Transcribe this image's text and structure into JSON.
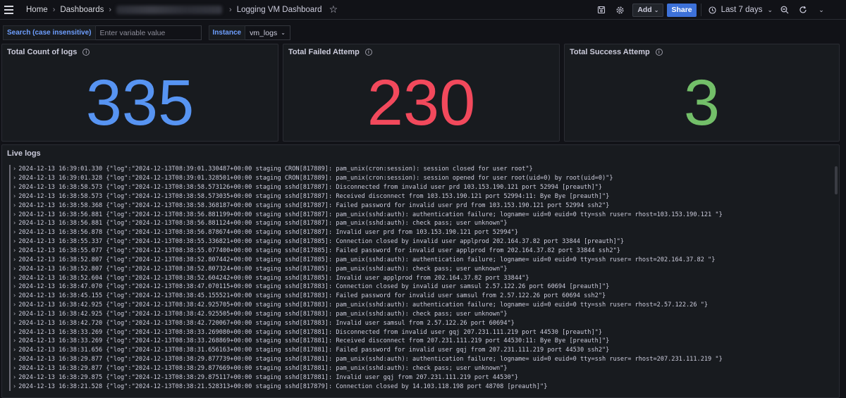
{
  "breadcrumb": {
    "home": "Home",
    "dashboards": "Dashboards",
    "current": "Logging VM Dashboard"
  },
  "toolbar": {
    "add_label": "Add",
    "share_label": "Share",
    "time_range": "Last 7 days"
  },
  "variables": {
    "search_label": "Search (case insensitive)",
    "search_placeholder": "Enter variable value",
    "instance_label": "Instance",
    "instance_value": "vm_logs"
  },
  "stats": [
    {
      "title": "Total Count of logs",
      "value": "335",
      "color": "#5794f2"
    },
    {
      "title": "Total Failed Attemp",
      "value": "230",
      "color": "#f2495c"
    },
    {
      "title": "Total Success Attemp",
      "value": "3",
      "color": "#73bf69"
    }
  ],
  "logs": {
    "title": "Live logs",
    "lines": [
      "2024-12-13 16:39:01.330 {\"log\":\"2024-12-13T08:39:01.330487+00:00 staging CRON[817889]: pam_unix(cron:session): session closed for user root\"}",
      "2024-12-13 16:39:01.328 {\"log\":\"2024-12-13T08:39:01.328501+00:00 staging CRON[817889]: pam_unix(cron:session): session opened for user root(uid=0) by root(uid=0)\"}",
      "2024-12-13 16:38:58.573 {\"log\":\"2024-12-13T08:38:58.573126+00:00 staging sshd[817887]: Disconnected from invalid user prd 103.153.190.121 port 52994 [preauth]\"}",
      "2024-12-13 16:38:58.573 {\"log\":\"2024-12-13T08:38:58.573035+00:00 staging sshd[817887]: Received disconnect from 103.153.190.121 port 52994:11: Bye Bye [preauth]\"}",
      "2024-12-13 16:38:58.368 {\"log\":\"2024-12-13T08:38:58.368187+00:00 staging sshd[817887]: Failed password for invalid user prd from 103.153.190.121 port 52994 ssh2\"}",
      "2024-12-13 16:38:56.881 {\"log\":\"2024-12-13T08:38:56.881199+00:00 staging sshd[817887]: pam_unix(sshd:auth): authentication failure; logname= uid=0 euid=0 tty=ssh ruser= rhost=103.153.190.121 \"}",
      "2024-12-13 16:38:56.881 {\"log\":\"2024-12-13T08:38:56.881124+00:00 staging sshd[817887]: pam_unix(sshd:auth): check pass; user unknown\"}",
      "2024-12-13 16:38:56.878 {\"log\":\"2024-12-13T08:38:56.878674+00:00 staging sshd[817887]: Invalid user prd from 103.153.190.121 port 52994\"}",
      "2024-12-13 16:38:55.337 {\"log\":\"2024-12-13T08:38:55.336821+00:00 staging sshd[817885]: Connection closed by invalid user applprod 202.164.37.82 port 33844 [preauth]\"}",
      "2024-12-13 16:38:55.077 {\"log\":\"2024-12-13T08:38:55.077400+00:00 staging sshd[817885]: Failed password for invalid user applprod from 202.164.37.82 port 33844 ssh2\"}",
      "2024-12-13 16:38:52.807 {\"log\":\"2024-12-13T08:38:52.807442+00:00 staging sshd[817885]: pam_unix(sshd:auth): authentication failure; logname= uid=0 euid=0 tty=ssh ruser= rhost=202.164.37.82 \"}",
      "2024-12-13 16:38:52.807 {\"log\":\"2024-12-13T08:38:52.807324+00:00 staging sshd[817885]: pam_unix(sshd:auth): check pass; user unknown\"}",
      "2024-12-13 16:38:52.604 {\"log\":\"2024-12-13T08:38:52.604242+00:00 staging sshd[817885]: Invalid user applprod from 202.164.37.82 port 33844\"}",
      "2024-12-13 16:38:47.070 {\"log\":\"2024-12-13T08:38:47.070115+00:00 staging sshd[817883]: Connection closed by invalid user samsul 2.57.122.26 port 60694 [preauth]\"}",
      "2024-12-13 16:38:45.155 {\"log\":\"2024-12-13T08:38:45.155521+00:00 staging sshd[817883]: Failed password for invalid user samsul from 2.57.122.26 port 60694 ssh2\"}",
      "2024-12-13 16:38:42.925 {\"log\":\"2024-12-13T08:38:42.925705+00:00 staging sshd[817883]: pam_unix(sshd:auth): authentication failure; logname= uid=0 euid=0 tty=ssh ruser= rhost=2.57.122.26 \"}",
      "2024-12-13 16:38:42.925 {\"log\":\"2024-12-13T08:38:42.925505+00:00 staging sshd[817883]: pam_unix(sshd:auth): check pass; user unknown\"}",
      "2024-12-13 16:38:42.720 {\"log\":\"2024-12-13T08:38:42.720067+00:00 staging sshd[817883]: Invalid user samsul from 2.57.122.26 port 60694\"}",
      "2024-12-13 16:38:33.269 {\"log\":\"2024-12-13T08:38:33.269080+00:00 staging sshd[817881]: Disconnected from invalid user gqj 207.231.111.219 port 44530 [preauth]\"}",
      "2024-12-13 16:38:33.269 {\"log\":\"2024-12-13T08:38:33.268869+00:00 staging sshd[817881]: Received disconnect from 207.231.111.219 port 44530:11: Bye Bye [preauth]\"}",
      "2024-12-13 16:38:31.656 {\"log\":\"2024-12-13T08:38:31.656163+00:00 staging sshd[817881]: Failed password for invalid user gqj from 207.231.111.219 port 44530 ssh2\"}",
      "2024-12-13 16:38:29.877 {\"log\":\"2024-12-13T08:38:29.877739+00:00 staging sshd[817881]: pam_unix(sshd:auth): authentication failure; logname= uid=0 euid=0 tty=ssh ruser= rhost=207.231.111.219 \"}",
      "2024-12-13 16:38:29.877 {\"log\":\"2024-12-13T08:38:29.877669+00:00 staging sshd[817881]: pam_unix(sshd:auth): check pass; user unknown\"}",
      "2024-12-13 16:38:29.875 {\"log\":\"2024-12-13T08:38:29.875117+00:00 staging sshd[817881]: Invalid user gqj from 207.231.111.219 port 44530\"}",
      "2024-12-13 16:38:21.528 {\"log\":\"2024-12-13T08:38:21.528313+00:00 staging sshd[817879]: Connection closed by 14.103.118.198 port 48708 [preauth]\"}"
    ]
  }
}
